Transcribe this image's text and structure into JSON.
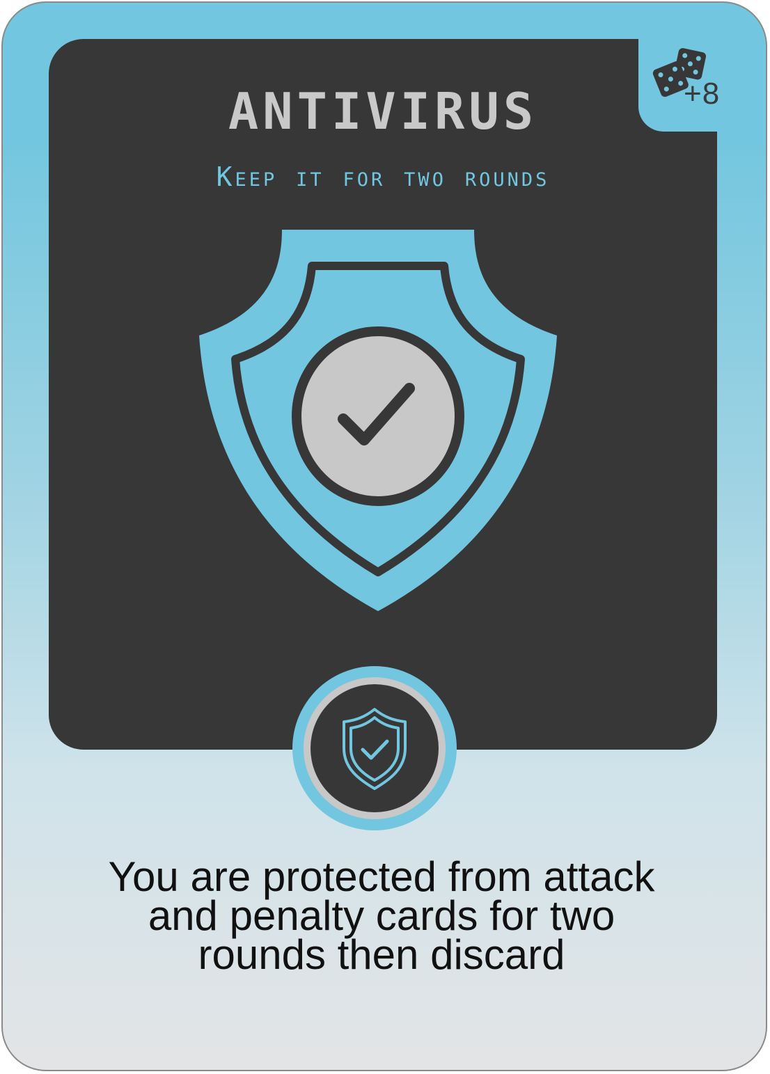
{
  "card": {
    "title": "ANTIVIRUS",
    "subtitle": "Keep it for two rounds",
    "bonus": "+8",
    "description_lines": [
      "You are protected from attack",
      "and penalty cards for two",
      "rounds then discard"
    ]
  },
  "colors": {
    "accent": "#72c6df",
    "panel": "#373737",
    "title": "#c9c9c9",
    "check_circle": "#c8c8c8"
  },
  "icons": {
    "corner": "dice-icon",
    "art": "shield-check-icon",
    "emblem": "shield-check-outline-icon"
  }
}
